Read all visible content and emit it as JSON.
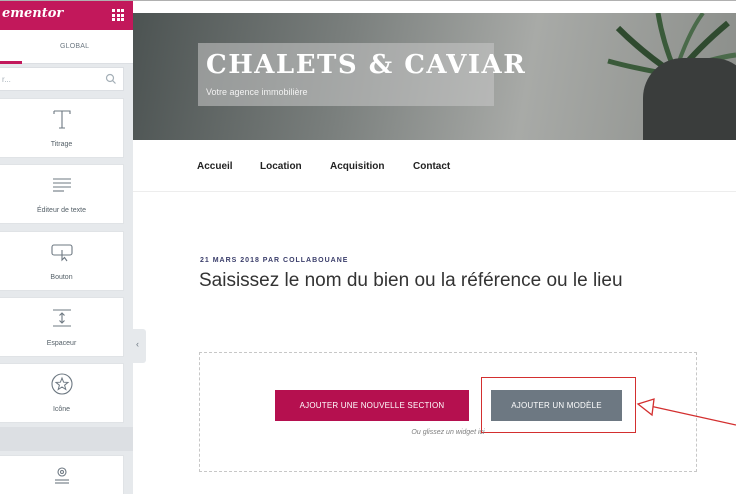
{
  "sidebar": {
    "logo": "ementor",
    "tab_global": "GLOBAL",
    "search_placeholder": "r...",
    "widgets": [
      {
        "label": "Titrage",
        "icon": "heading-icon"
      },
      {
        "label": "Éditeur de texte",
        "icon": "text-editor-icon"
      },
      {
        "label": "Bouton",
        "icon": "button-icon"
      },
      {
        "label": "Espaceur",
        "icon": "spacer-icon"
      },
      {
        "label": "Icône",
        "icon": "star-icon"
      },
      {
        "label": "",
        "icon": "widget-icon"
      }
    ],
    "collapse_glyph": "‹",
    "accent": "#c2185b"
  },
  "hero": {
    "title": "CHALETS & CAVIAR",
    "tagline": "Votre agence immobilière"
  },
  "nav": {
    "items": [
      "Accueil",
      "Location",
      "Acquisition",
      "Contact"
    ]
  },
  "post": {
    "meta": "21 MARS 2018 PAR COLLABOUANE",
    "title": "Saisissez le nom du bien ou la référence ou le lieu"
  },
  "dropzone": {
    "add_section_label": "AJOUTER UNE NOUVELLE SECTION",
    "add_template_label": "AJOUTER UN MODÈLE",
    "hint": "Ou glissez un widget ici",
    "section_color": "#b5104f",
    "template_color": "#6d7882"
  },
  "annotation": {
    "color": "#d32f2f"
  }
}
